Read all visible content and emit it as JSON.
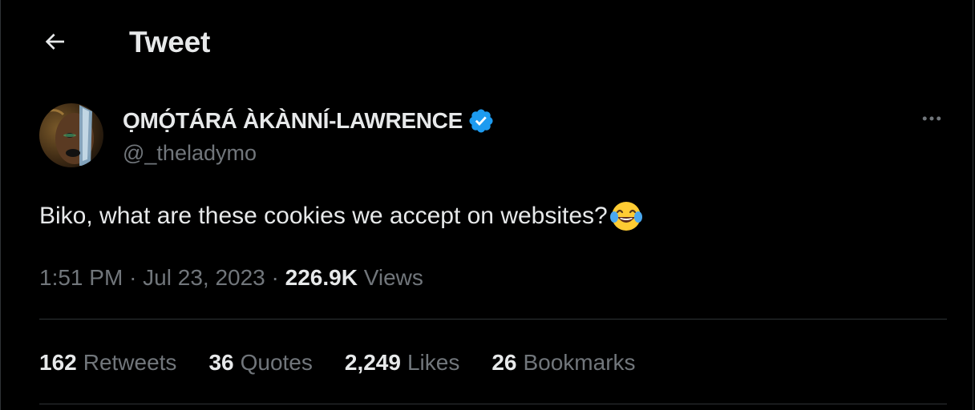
{
  "header": {
    "title": "Tweet",
    "back_icon": "arrow-left-icon"
  },
  "author": {
    "display_name": "ỌMỌ́TÁRÁ ÀKÀNNÍ-LAWRENCE",
    "handle": "@_theladymo",
    "verified": true,
    "badge_color": "#1d9bf0"
  },
  "tweet": {
    "text": "Biko, what are these cookies we accept on websites?",
    "emoji": "face-with-tears-of-joy"
  },
  "meta": {
    "time": "1:51 PM",
    "separator": "·",
    "date": "Jul 23, 2023",
    "views_count": "226.9K",
    "views_label": "Views"
  },
  "stats": {
    "retweets": {
      "count": "162",
      "label": "Retweets"
    },
    "quotes": {
      "count": "36",
      "label": "Quotes"
    },
    "likes": {
      "count": "2,249",
      "label": "Likes"
    },
    "bookmarks": {
      "count": "26",
      "label": "Bookmarks"
    }
  },
  "colors": {
    "background": "#000000",
    "primary_text": "#e7e9ea",
    "secondary_text": "#71767b",
    "divider": "#2f3336",
    "accent": "#1d9bf0"
  }
}
